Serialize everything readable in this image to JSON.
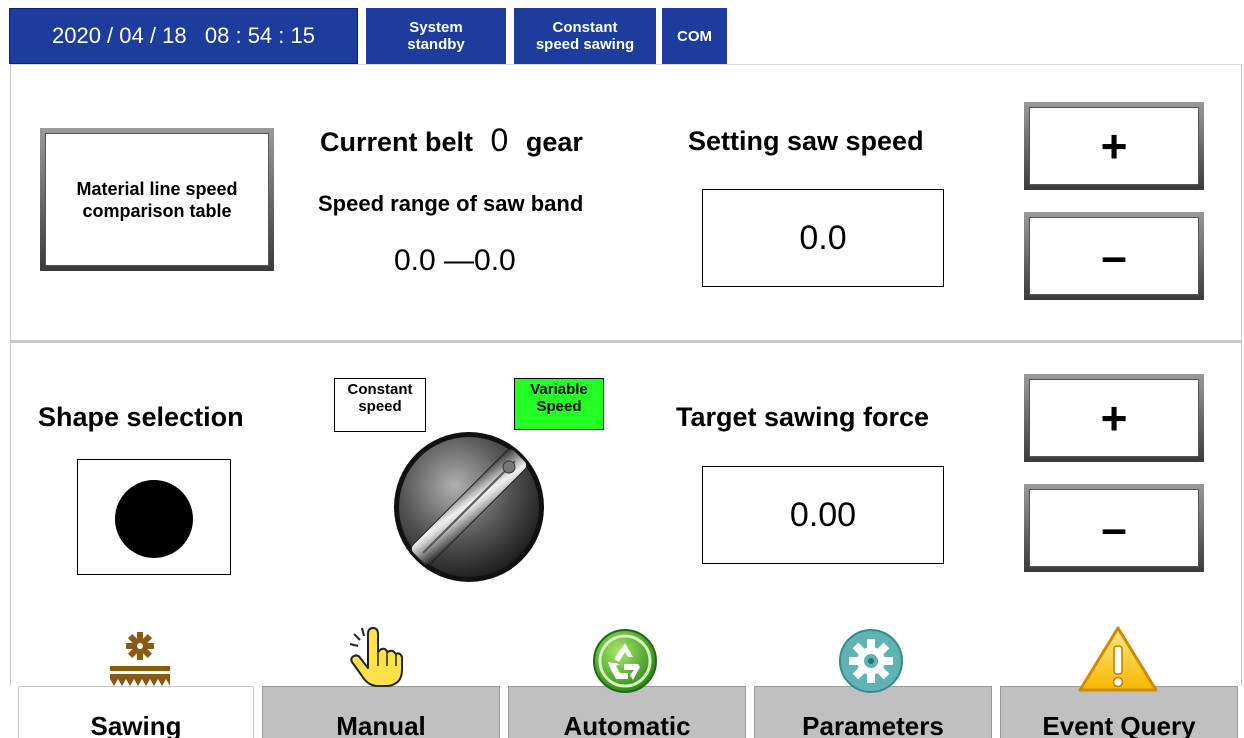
{
  "status_bar": {
    "datetime": "2020 / 04 / 18   08 : 54 : 15",
    "system_status": "System\nstandby",
    "sawing_mode": "Constant\nspeed sawing",
    "com": "COM"
  },
  "top_panel": {
    "material_button": "Material line speed\ncomparison table",
    "current_belt_label": "Current belt",
    "current_belt_value": "0",
    "current_belt_unit": "gear",
    "speed_range_label": "Speed range of saw band",
    "speed_range_value": "0.0 —0.0",
    "setting_saw_speed_label": "Setting saw speed",
    "setting_saw_speed_value": "0.0",
    "plus": "+",
    "minus": "–"
  },
  "bottom_panel": {
    "shape_selection_label": "Shape selection",
    "constant_speed_tag": "Constant\nspeed",
    "variable_speed_tag": "Variable\nSpeed",
    "target_force_label": "Target sawing force",
    "target_force_value": "0.00",
    "plus": "+",
    "minus": "–"
  },
  "tabs": [
    {
      "label": "Sawing",
      "icon": "saw-blade-icon"
    },
    {
      "label": "Manual",
      "icon": "hand-pointer-icon"
    },
    {
      "label": "Automatic",
      "icon": "recycle-icon"
    },
    {
      "label": "Parameters",
      "icon": "gear-icon"
    },
    {
      "label": "Event Query",
      "icon": "warning-icon"
    }
  ],
  "colors": {
    "status_bar": "#1c3c9e",
    "variable_speed_active": "#22ff22",
    "tab_inactive": "#c0c0c0",
    "tab_active": "#ffffff"
  }
}
